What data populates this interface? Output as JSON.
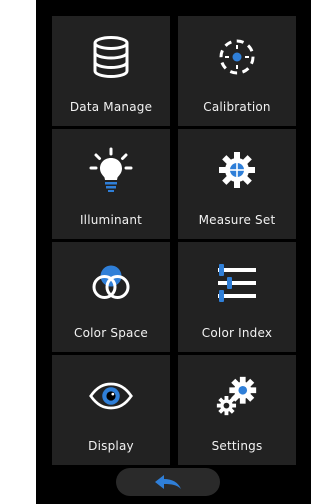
{
  "menu": {
    "tiles": [
      {
        "label": "Data Manage",
        "icon": "database-icon"
      },
      {
        "label": "Calibration",
        "icon": "calibration-target-icon"
      },
      {
        "label": "Illuminant",
        "icon": "light-bulb-icon"
      },
      {
        "label": "Measure Set",
        "icon": "gear-crosshair-icon"
      },
      {
        "label": "Color Space",
        "icon": "rgb-circles-icon"
      },
      {
        "label": "Color Index",
        "icon": "sliders-icon"
      },
      {
        "label": "Display",
        "icon": "eye-icon"
      },
      {
        "label": "Settings",
        "icon": "gears-icon"
      }
    ]
  },
  "back_button": {
    "icon": "back-arrow-icon"
  },
  "colors": {
    "background": "#000000",
    "tile": "#222222",
    "accent_blue": "#2f7fd8",
    "text": "#ffffff"
  }
}
